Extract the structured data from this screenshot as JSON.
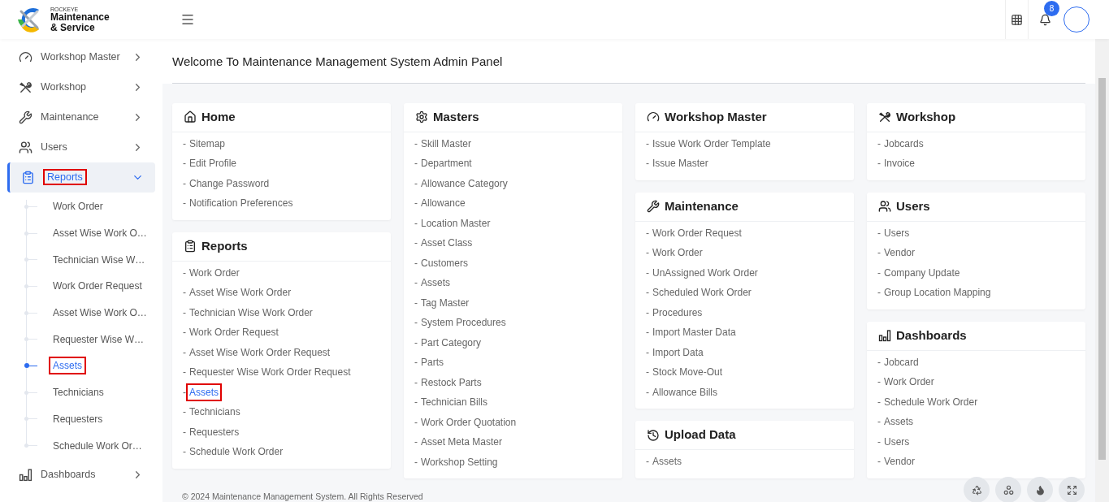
{
  "brand": {
    "small": "ROCKEYE",
    "line1": "Maintenance",
    "line2": "& Service"
  },
  "header": {
    "notification_count": "8"
  },
  "sidebar": {
    "items": [
      {
        "label": "Workshop Master",
        "selected": false,
        "expanded": false,
        "highlighted": false
      },
      {
        "label": "Workshop",
        "selected": false,
        "expanded": false,
        "highlighted": false
      },
      {
        "label": "Maintenance",
        "selected": false,
        "expanded": false,
        "highlighted": false
      },
      {
        "label": "Users",
        "selected": false,
        "expanded": false,
        "highlighted": false
      },
      {
        "label": "Reports",
        "selected": true,
        "expanded": true,
        "highlighted": true,
        "children": [
          {
            "label": "Work Order",
            "selected": false,
            "highlighted": false
          },
          {
            "label": "Asset Wise Work O…",
            "selected": false,
            "highlighted": false
          },
          {
            "label": "Technician Wise W…",
            "selected": false,
            "highlighted": false
          },
          {
            "label": "Work Order Request",
            "selected": false,
            "highlighted": false
          },
          {
            "label": "Asset Wise Work O…",
            "selected": false,
            "highlighted": false
          },
          {
            "label": "Requester Wise W…",
            "selected": false,
            "highlighted": false
          },
          {
            "label": "Assets",
            "selected": true,
            "highlighted": true
          },
          {
            "label": "Technicians",
            "selected": false,
            "highlighted": false
          },
          {
            "label": "Requesters",
            "selected": false,
            "highlighted": false
          },
          {
            "label": "Schedule Work Or…",
            "selected": false,
            "highlighted": false
          }
        ]
      },
      {
        "label": "Dashboards",
        "selected": false,
        "expanded": false,
        "highlighted": false
      }
    ]
  },
  "page_title": "Welcome To Maintenance Management System Admin Panel",
  "columns": [
    [
      {
        "title": "Home",
        "links": [
          {
            "bullet": "-",
            "label": "Sitemap",
            "highlighted": false
          },
          {
            "bullet": "-",
            "label": "Edit Profile",
            "highlighted": false
          },
          {
            "bullet": "-",
            "label": "Change Password",
            "highlighted": false
          },
          {
            "bullet": "-",
            "label": "Notification Preferences",
            "highlighted": false
          }
        ]
      },
      {
        "title": "Reports",
        "links": [
          {
            "bullet": "-",
            "label": "Work Order",
            "highlighted": false
          },
          {
            "bullet": "-",
            "label": "Asset Wise Work Order",
            "highlighted": false
          },
          {
            "bullet": "-",
            "label": "Technician Wise Work Order",
            "highlighted": false
          },
          {
            "bullet": "-",
            "label": "Work Order Request",
            "highlighted": false
          },
          {
            "bullet": "-",
            "label": "Asset Wise Work Order Request",
            "highlighted": false
          },
          {
            "bullet": "-",
            "label": "Requester Wise Work Order Request",
            "highlighted": false
          },
          {
            "bullet": "-",
            "label": "Assets",
            "highlighted": true
          },
          {
            "bullet": "-",
            "label": "Technicians",
            "highlighted": false
          },
          {
            "bullet": "-",
            "label": "Requesters",
            "highlighted": false
          },
          {
            "bullet": "-",
            "label": "Schedule Work Order",
            "highlighted": false
          }
        ]
      }
    ],
    [
      {
        "title": "Masters",
        "links": [
          {
            "bullet": "-",
            "label": "Skill Master",
            "highlighted": false
          },
          {
            "bullet": "-",
            "label": "Department",
            "highlighted": false
          },
          {
            "bullet": "-",
            "label": "Allowance Category",
            "highlighted": false
          },
          {
            "bullet": "-",
            "label": "Allowance",
            "highlighted": false
          },
          {
            "bullet": "-",
            "label": "Location Master",
            "highlighted": false
          },
          {
            "bullet": "-",
            "label": "Asset Class",
            "highlighted": false
          },
          {
            "bullet": "-",
            "label": "Customers",
            "highlighted": false
          },
          {
            "bullet": "-",
            "label": "Assets",
            "highlighted": false
          },
          {
            "bullet": "-",
            "label": "Tag Master",
            "highlighted": false
          },
          {
            "bullet": "-",
            "label": "System Procedures",
            "highlighted": false
          },
          {
            "bullet": "-",
            "label": "Part Category",
            "highlighted": false
          },
          {
            "bullet": "-",
            "label": "Parts",
            "highlighted": false
          },
          {
            "bullet": "-",
            "label": "Restock Parts",
            "highlighted": false
          },
          {
            "bullet": "-",
            "label": "Technician Bills",
            "highlighted": false
          },
          {
            "bullet": "-",
            "label": "Work Order Quotation",
            "highlighted": false
          },
          {
            "bullet": "-",
            "label": "Asset Meta Master",
            "highlighted": false
          },
          {
            "bullet": "-",
            "label": "Workshop Setting",
            "highlighted": false
          }
        ]
      }
    ],
    [
      {
        "title": "Workshop Master",
        "links": [
          {
            "bullet": "-",
            "label": "Issue Work Order Template",
            "highlighted": false
          },
          {
            "bullet": "-",
            "label": "Issue Master",
            "highlighted": false
          }
        ]
      },
      {
        "title": "Maintenance",
        "links": [
          {
            "bullet": "-",
            "label": "Work Order Request",
            "highlighted": false
          },
          {
            "bullet": "-",
            "label": "Work Order",
            "highlighted": false
          },
          {
            "bullet": "-",
            "label": "UnAssigned Work Order",
            "highlighted": false
          },
          {
            "bullet": "-",
            "label": "Scheduled Work Order",
            "highlighted": false
          },
          {
            "bullet": "-",
            "label": "Procedures",
            "highlighted": false
          },
          {
            "bullet": "-",
            "label": "Import Master Data",
            "highlighted": false
          },
          {
            "bullet": "-",
            "label": "Import Data",
            "highlighted": false
          },
          {
            "bullet": "-",
            "label": "Stock Move-Out",
            "highlighted": false
          },
          {
            "bullet": "-",
            "label": "Allowance Bills",
            "highlighted": false
          }
        ]
      },
      {
        "title": "Upload Data",
        "links": [
          {
            "bullet": "-",
            "label": "Assets",
            "highlighted": false
          }
        ]
      }
    ],
    [
      {
        "title": "Workshop",
        "links": [
          {
            "bullet": "-",
            "label": "Jobcards",
            "highlighted": false
          },
          {
            "bullet": "-",
            "label": "Invoice",
            "highlighted": false
          }
        ]
      },
      {
        "title": "Users",
        "links": [
          {
            "bullet": "-",
            "label": "Users",
            "highlighted": false
          },
          {
            "bullet": "-",
            "label": "Vendor",
            "highlighted": false
          },
          {
            "bullet": "-",
            "label": "Company Update",
            "highlighted": false
          },
          {
            "bullet": "-",
            "label": "Group Location Mapping",
            "highlighted": false
          }
        ]
      },
      {
        "title": "Dashboards",
        "links": [
          {
            "bullet": "-",
            "label": "Jobcard",
            "highlighted": false
          },
          {
            "bullet": "-",
            "label": "Work Order",
            "highlighted": false
          },
          {
            "bullet": "-",
            "label": "Schedule Work Order",
            "highlighted": false
          },
          {
            "bullet": "-",
            "label": "Assets",
            "highlighted": false
          },
          {
            "bullet": "-",
            "label": "Users",
            "highlighted": false
          },
          {
            "bullet": "-",
            "label": "Vendor",
            "highlighted": false
          }
        ]
      }
    ]
  ],
  "footer": "© 2024 Maintenance Management System. All Rights Reserved"
}
